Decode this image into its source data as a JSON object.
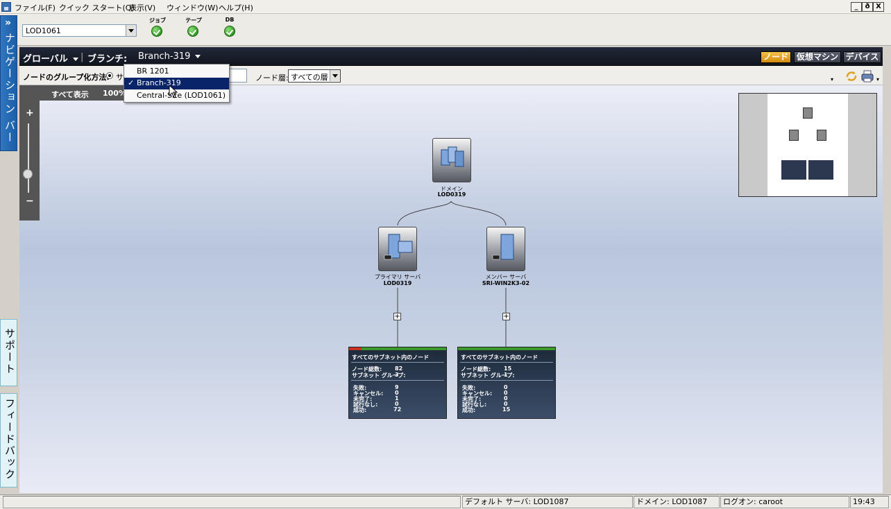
{
  "menubar": {
    "items": [
      "ファイル(F)",
      "クイック スタート(Q)",
      "表示(V)",
      "ウィンドウ(W)",
      "ヘルプ(H)"
    ],
    "window_controls": [
      "_",
      "ð",
      "X"
    ]
  },
  "toolbar": {
    "server": "LOD1061",
    "status": [
      {
        "label": "ジョブ",
        "state": "ok"
      },
      {
        "label": "テープ",
        "state": "ok"
      },
      {
        "label": "DB",
        "state": "ok"
      }
    ]
  },
  "sidebars": {
    "navigation": "ナビゲーション バー",
    "support": "サポート",
    "feedback": "フィードバック"
  },
  "header": {
    "global": "グローバル",
    "branch_label": "ブランチ:",
    "branch_value": "Branch-319",
    "view_tabs": [
      "ノード",
      "仮想マシン",
      "デバイス"
    ],
    "active_tab": "ノード"
  },
  "filter": {
    "group_by_label": "ノードのグループ化方法:",
    "radio_text": "サ",
    "layer_label": "ノード層:",
    "layer_value": "すべての層"
  },
  "zoom": {
    "show_all": "すべて表示",
    "percent": "100%",
    "plus": "+",
    "minus": "−"
  },
  "branch_dropdown": {
    "items": [
      "BR 1201",
      "Branch-319",
      "Central-Site (LOD1061)"
    ],
    "selected": "Branch-319",
    "check": "✓"
  },
  "topology": {
    "domain": {
      "type": "ドメイン",
      "name": "LOD0319"
    },
    "servers": [
      {
        "type": "プライマリ サーバ",
        "name": "LOD0319"
      },
      {
        "type": "メンバー サーバ",
        "name": "SRI-WIN2K3-02"
      }
    ],
    "expand": "+",
    "cards": [
      {
        "title": "すべてのサブネット内のノード",
        "total_label": "ノード総数:",
        "total": "82",
        "groups_label": "サブネット グループ:",
        "groups": "3",
        "failed_label": "失敗:",
        "failed": "9",
        "cancel_label": "キャンセル:",
        "cancel": "0",
        "incomplete_label": "未完了:",
        "incomplete": "1",
        "notrun_label": "試行なし:",
        "notrun": "0",
        "success_label": "成功:",
        "success": "72"
      },
      {
        "title": "すべてのサブネット内のノード",
        "total_label": "ノード総数:",
        "total": "15",
        "groups_label": "サブネット グループ:",
        "groups": "1",
        "failed_label": "失敗:",
        "failed": "0",
        "cancel_label": "キャンセル:",
        "cancel": "0",
        "incomplete_label": "未完了:",
        "incomplete": "0",
        "notrun_label": "試行なし:",
        "notrun": "0",
        "success_label": "成功:",
        "success": "15"
      }
    ]
  },
  "statusbar": {
    "default_server": "デフォルト サーバ: LOD1087",
    "domain": "ドメイン: LOD1087",
    "logon": "ログオン: caroot",
    "time": "19:43"
  },
  "colors": {
    "accent": "#f6c14a",
    "header_bg": "#1a1f2b",
    "status_ok": "#2f9b22",
    "selection": "#0a246a"
  }
}
